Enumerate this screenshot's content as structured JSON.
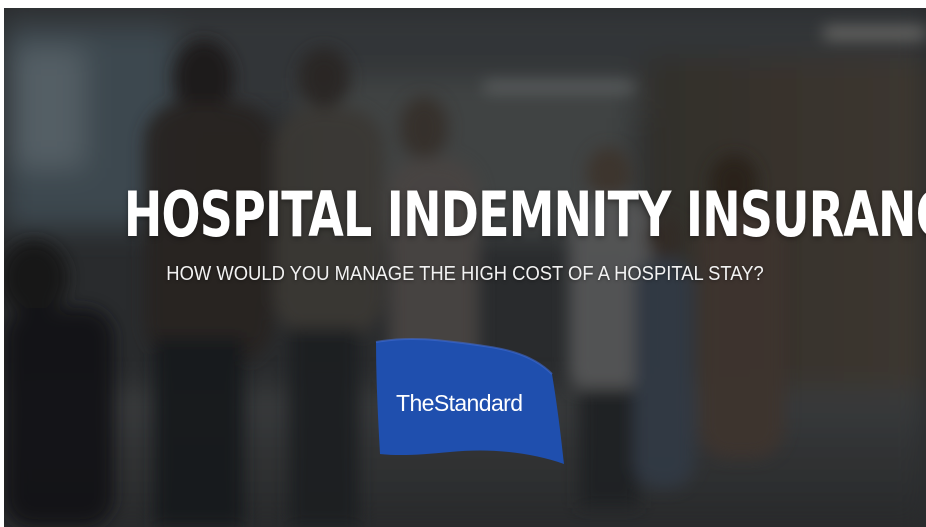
{
  "title": "HOSPITAL INDEMNITY INSURANCE",
  "subtitle": "HOW WOULD YOU MANAGE THE HIGH COST OF A HOSPITAL STAY?",
  "logo": {
    "wordmark": "TheStandard",
    "flag_color": "#1f4fae"
  },
  "background": {
    "description_icon": "blurred-hospital-hallway-photo"
  }
}
